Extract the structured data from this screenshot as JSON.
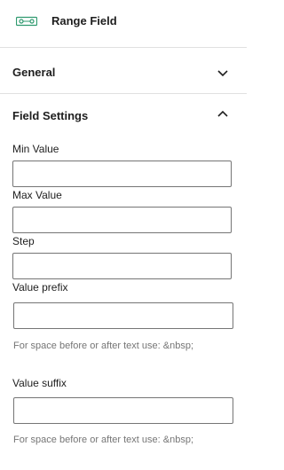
{
  "block": {
    "icon": "range-slider-icon",
    "title": "Range Field"
  },
  "panels": {
    "general": {
      "label": "General",
      "state": "collapsed",
      "icon": "chevron-down-icon"
    },
    "settings": {
      "label": "Field Settings",
      "state": "expanded",
      "icon": "chevron-up-icon"
    }
  },
  "fields": {
    "min": {
      "label": "Min Value",
      "value": ""
    },
    "max": {
      "label": "Max Value",
      "value": ""
    },
    "step": {
      "label": "Step",
      "value": ""
    },
    "prefix": {
      "label": "Value prefix",
      "value": "",
      "help": "For space before or after text use: &nbsp;"
    },
    "suffix": {
      "label": "Value suffix",
      "value": "",
      "help": "For space before or after text use: &nbsp;"
    }
  },
  "colors": {
    "border": "#757575",
    "divider": "#e0e0e0",
    "accent": "#2f9a6f",
    "help_text": "#757575"
  }
}
